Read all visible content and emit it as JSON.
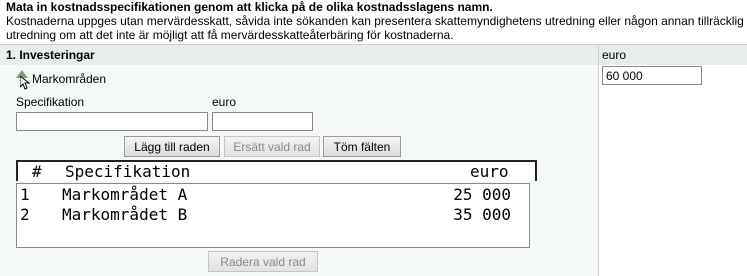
{
  "intro": {
    "heading": "Mata in kostnadsspecifikationen genom att klicka på de olika kostnadsslagens namn.",
    "line1": "Kostnaderna uppges utan mervärdesskatt, såvida inte sökanden kan presentera skattemyndighetens utredning eller någon annan tillräcklig",
    "line2": "utredning om att det inte är möjligt att få mervärdesskatteåterbäring för kostnaderna."
  },
  "table": {
    "section_title": "1. Investeringar",
    "euro_header": "euro",
    "euro_total": "60 000"
  },
  "section": {
    "name": "Markområden",
    "spec_label": "Specifikation",
    "euro_label": "euro",
    "spec_value": "",
    "euro_value": ""
  },
  "buttons": {
    "add": "Lägg till raden",
    "replace": "Ersätt vald rad",
    "clear": "Töm fälten",
    "delete": "Radera vald rad"
  },
  "list": {
    "headers": {
      "num": "#",
      "spec": "Specifikation",
      "euro": "euro"
    },
    "rows": [
      {
        "num": "1",
        "spec": "Markområdet A",
        "euro": "25 000"
      },
      {
        "num": "2",
        "spec": "Markområdet B",
        "euro": "35 000"
      }
    ]
  },
  "colors": {
    "panel_bg": "#f4f8f6",
    "header_bg": "#e8ede9",
    "toggle": "#7aa37a"
  },
  "icons": {
    "toggle": "triangle-up-icon",
    "cursor": "mouse-pointer-icon"
  }
}
